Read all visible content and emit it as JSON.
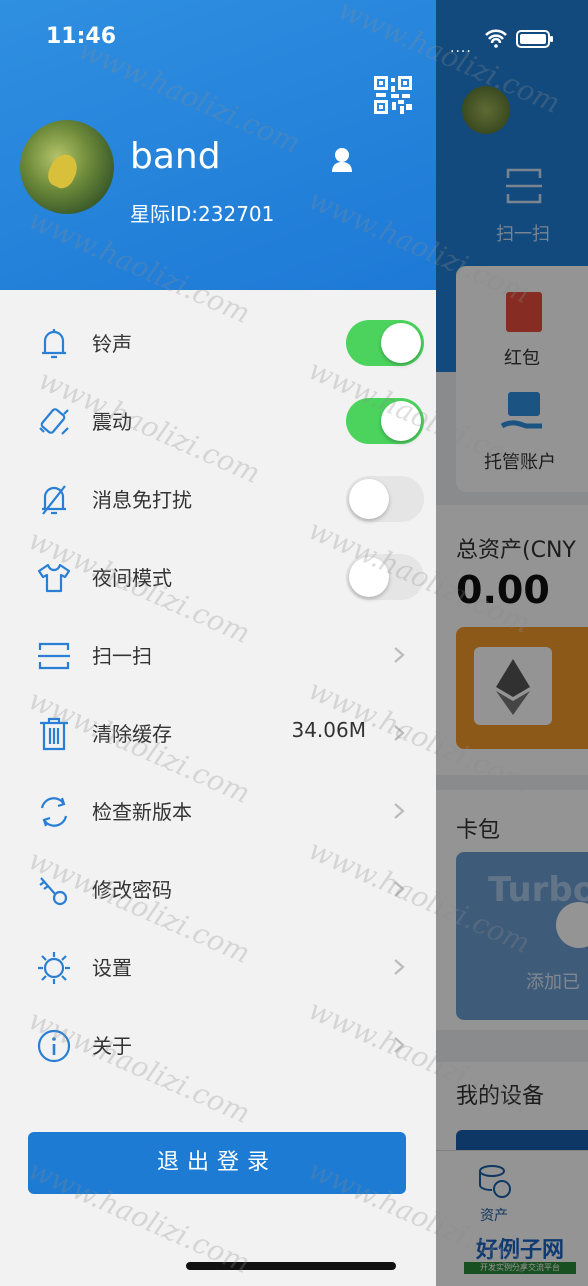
{
  "status_bar": {
    "time": "11:46"
  },
  "profile": {
    "username": "band",
    "user_id": "星际ID:232701"
  },
  "menu": [
    {
      "label": "铃声",
      "icon": "bell-icon",
      "type": "toggle",
      "on": true
    },
    {
      "label": "震动",
      "icon": "vibrate-icon",
      "type": "toggle",
      "on": true
    },
    {
      "label": "消息免打扰",
      "icon": "bell-off-icon",
      "type": "toggle",
      "on": false
    },
    {
      "label": "夜间模式",
      "icon": "shirt-icon",
      "type": "toggle",
      "on": false
    },
    {
      "label": "扫一扫",
      "icon": "scan-icon",
      "type": "link"
    },
    {
      "label": "清除缓存",
      "icon": "trash-icon",
      "type": "link",
      "value": "34.06M"
    },
    {
      "label": "检查新版本",
      "icon": "refresh-icon",
      "type": "link"
    },
    {
      "label": "修改密码",
      "icon": "key-icon",
      "type": "link"
    },
    {
      "label": "设置",
      "icon": "gear-icon",
      "type": "link"
    },
    {
      "label": "关于",
      "icon": "info-icon",
      "type": "link"
    }
  ],
  "logout_label": "退出登录",
  "background": {
    "scan": "扫一扫",
    "red_packet": "红包",
    "custody": "托管账户",
    "total_assets": "总资产(CNY",
    "total_value": "0.00",
    "card_pack": "卡包",
    "card_brand": "Turbo",
    "add_label": "添加已",
    "my_devices": "我的设备",
    "tab_assets": "资产"
  },
  "watermark": {
    "text": "www.haolizi.com",
    "brand": "好例子网",
    "brand_sub": "开发实例分享交流平台"
  },
  "colors": {
    "primary": "#1d7bd3",
    "toggle_on": "#4cd35e",
    "toggle_off": "#e5e5e5",
    "drawer_bg": "#f2f2f2"
  }
}
